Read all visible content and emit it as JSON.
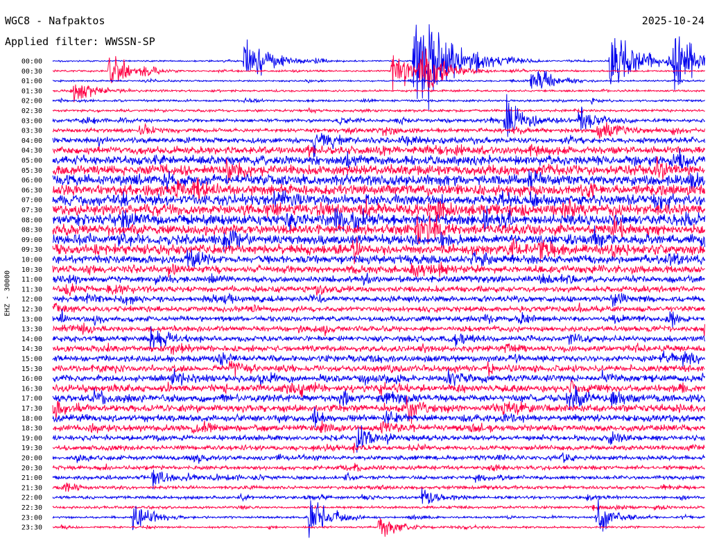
{
  "header": {
    "station": "WGC8 - Nafpaktos",
    "date": "2025-10-24",
    "filter": "Applied filter: WWSSN-SP"
  },
  "chart_data": {
    "type": "line",
    "subtype": "helicorder",
    "title": "WGC8 - Nafpaktos",
    "subtitle": "Applied filter: WWSSN-SP",
    "ylabel": "EHZ - 30000",
    "xlabel": "",
    "grid": false,
    "colors": [
      "#0000ee",
      "#ff0044"
    ],
    "row_minutes": 30,
    "row_labels": [
      "00:00",
      "00:30",
      "01:00",
      "01:30",
      "02:00",
      "02:30",
      "03:00",
      "03:30",
      "04:00",
      "04:30",
      "05:00",
      "05:30",
      "06:00",
      "06:30",
      "07:00",
      "07:30",
      "08:00",
      "08:30",
      "09:00",
      "09:30",
      "10:00",
      "10:30",
      "11:00",
      "11:30",
      "12:00",
      "12:30",
      "13:00",
      "13:30",
      "14:00",
      "14:30",
      "15:00",
      "15:30",
      "16:00",
      "16:30",
      "17:00",
      "17:30",
      "18:00",
      "18:30",
      "19:00",
      "19:30",
      "20:00",
      "20:30",
      "21:00",
      "21:30",
      "22:00",
      "22:30",
      "23:00",
      "23:30"
    ],
    "noise_level": [
      0.05,
      0.07,
      0.06,
      0.08,
      0.1,
      0.13,
      0.2,
      0.28,
      0.38,
      0.55,
      0.65,
      0.75,
      0.8,
      0.8,
      0.8,
      0.82,
      0.8,
      0.78,
      0.75,
      0.72,
      0.62,
      0.55,
      0.45,
      0.42,
      0.4,
      0.38,
      0.36,
      0.38,
      0.4,
      0.42,
      0.44,
      0.46,
      0.5,
      0.52,
      0.52,
      0.5,
      0.47,
      0.44,
      0.36,
      0.3,
      0.28,
      0.25,
      0.23,
      0.2,
      0.16,
      0.13,
      0.1,
      0.08
    ],
    "events": [
      {
        "row": 0,
        "minute": 8.8,
        "amplitude": 2.7
      },
      {
        "row": 0,
        "minute": 16.6,
        "amplitude": 5.4
      },
      {
        "row": 0,
        "minute": 25.6,
        "amplitude": 3.4
      },
      {
        "row": 0,
        "minute": 28.5,
        "amplitude": 3.1
      },
      {
        "row": 1,
        "minute": 2.6,
        "amplitude": 2.2
      },
      {
        "row": 1,
        "minute": 15.6,
        "amplitude": 2.1
      },
      {
        "row": 1,
        "minute": 16.9,
        "amplitude": 2.3
      },
      {
        "row": 2,
        "minute": 22.0,
        "amplitude": 1.8
      },
      {
        "row": 3,
        "minute": 1.0,
        "amplitude": 1.6
      },
      {
        "row": 6,
        "minute": 20.8,
        "amplitude": 2.0
      },
      {
        "row": 6,
        "minute": 24.2,
        "amplitude": 1.4
      },
      {
        "row": 7,
        "minute": 25.0,
        "amplitude": 1.3
      },
      {
        "row": 8,
        "minute": 12.0,
        "amplitude": 1.2
      },
      {
        "row": 16,
        "minute": 13.0,
        "amplitude": 1.1
      },
      {
        "row": 28,
        "minute": 4.5,
        "amplitude": 0.9
      },
      {
        "row": 35,
        "minute": 16.3,
        "amplitude": 1.1
      },
      {
        "row": 38,
        "minute": 14.0,
        "amplitude": 1.0
      },
      {
        "row": 42,
        "minute": 4.6,
        "amplitude": 0.9
      },
      {
        "row": 44,
        "minute": 17.0,
        "amplitude": 1.0
      },
      {
        "row": 46,
        "minute": 3.7,
        "amplitude": 1.4
      },
      {
        "row": 46,
        "minute": 11.8,
        "amplitude": 1.9
      },
      {
        "row": 46,
        "minute": 25.0,
        "amplitude": 1.6
      },
      {
        "row": 47,
        "minute": 15.0,
        "amplitude": 1.3
      }
    ]
  }
}
